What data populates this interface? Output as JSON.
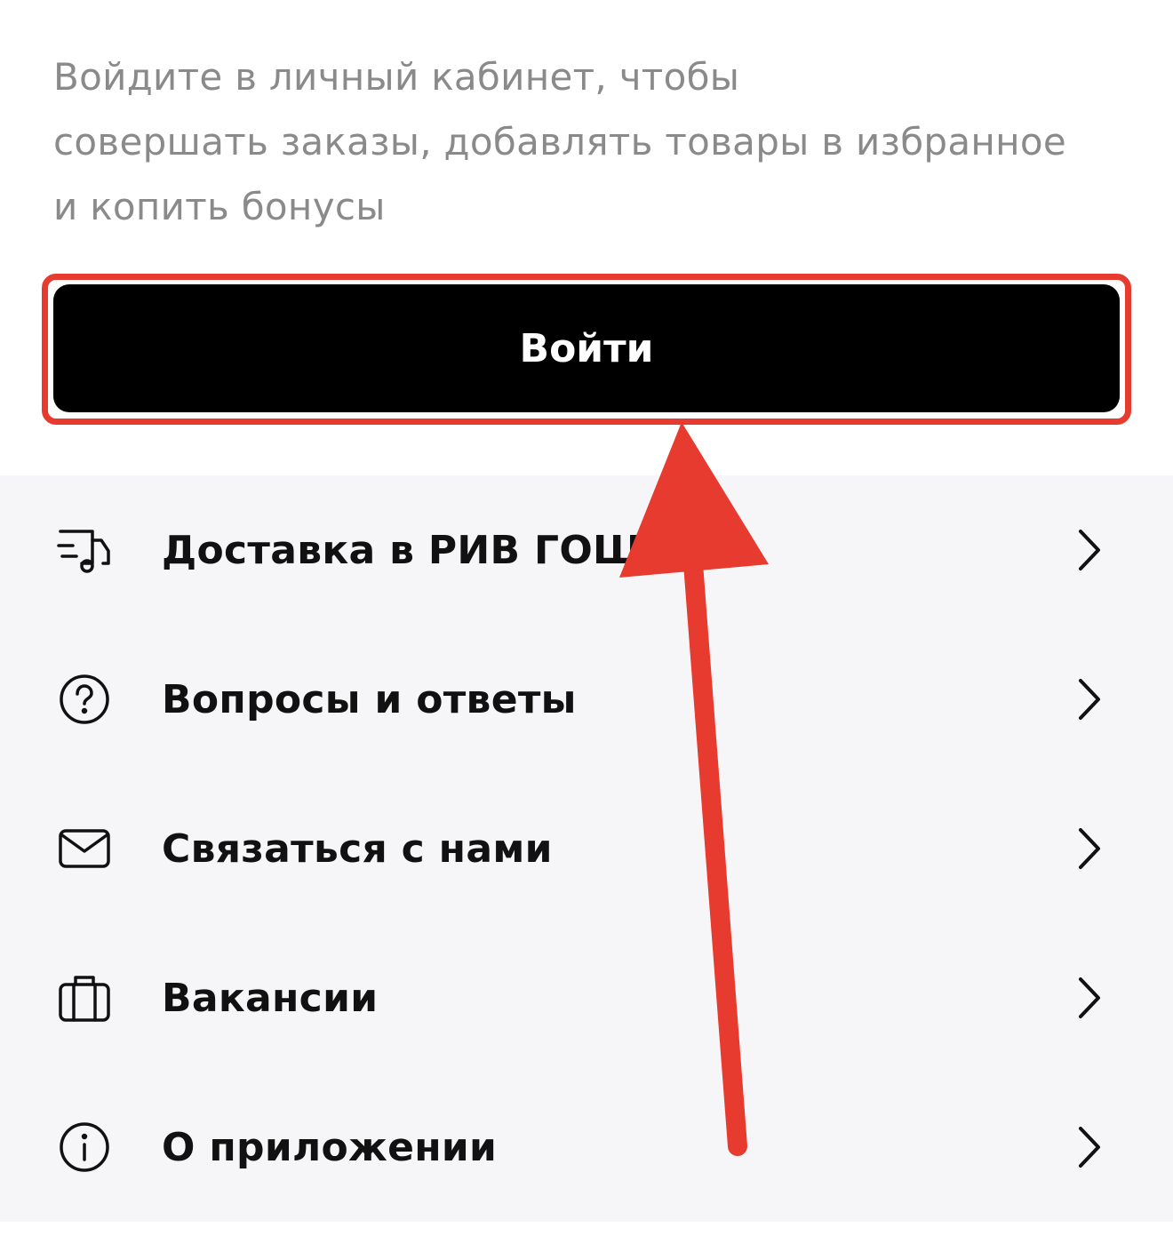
{
  "intro": {
    "line1": "Войдите в личный кабинет, чтобы",
    "line2": "совершать заказы, добавлять товары в избранное",
    "line3": "и копить бонусы"
  },
  "login": {
    "label": "Войти"
  },
  "menu": {
    "items": [
      {
        "label": "Доставка в РИВ ГОШ",
        "icon": "delivery-truck-icon"
      },
      {
        "label": "Вопросы и ответы",
        "icon": "question-circle-icon"
      },
      {
        "label": "Связаться с нами",
        "icon": "mail-icon"
      },
      {
        "label": "Вакансии",
        "icon": "briefcase-icon"
      },
      {
        "label": "О приложении",
        "icon": "info-circle-icon"
      }
    ]
  },
  "annotation": {
    "highlight_color": "#e63b2e"
  }
}
